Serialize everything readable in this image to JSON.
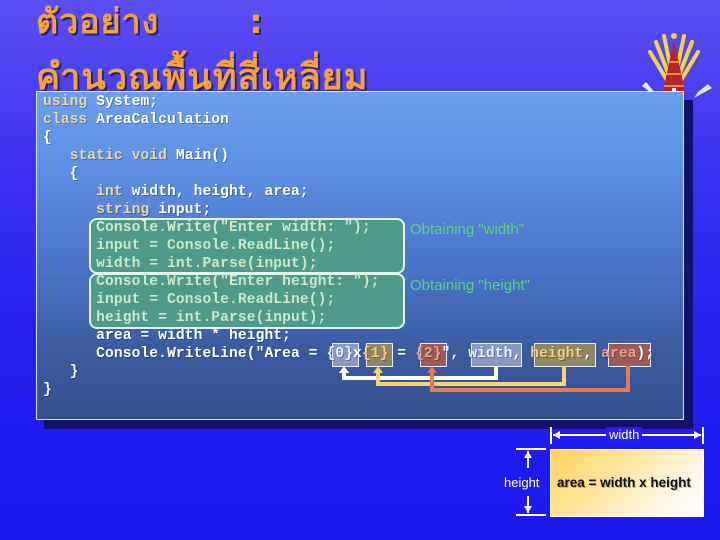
{
  "slide": {
    "title_line1": "ตัวอย่าง       :",
    "title_line2": "คำนวณพื้นที่สี่เหลี่ยม",
    "title_color": "#f4a23a"
  },
  "code": {
    "lines": [
      {
        "kw": "using",
        "rest": " System;"
      },
      {
        "kw": "class",
        "rest": " AreaCalculation"
      },
      {
        "kw": "",
        "rest": "{"
      },
      {
        "kw": "   static void",
        "rest": " Main()"
      },
      {
        "kw": "",
        "rest": "   {"
      },
      {
        "kw": "      int",
        "rest": " width, height, area;"
      },
      {
        "kw": "      string",
        "rest": " input;"
      }
    ],
    "width_block": [
      "      Console.Write(\"Enter width: \");",
      "      input = Console.ReadLine();",
      "      width = int.Parse(input);"
    ],
    "height_block": [
      "      Console.Write(\"Enter height: \");",
      "      input = Console.ReadLine();",
      "      height = int.Parse(input);"
    ],
    "area_line": "      area = width * height;",
    "writeline": {
      "prefix": "      Console.WriteLine(\"Area = ",
      "ph0": "{0}",
      "x": "x",
      "ph1": "{1}",
      "eq": " = ",
      "ph2": "{2}",
      "quote_comma": "\", ",
      "arg_width": "width",
      "comma1": ", ",
      "arg_height": "height",
      "comma2": ", ",
      "arg_area": "area",
      "suffix": ");"
    },
    "close_inner": "   }",
    "close_outer": "}"
  },
  "annotations": {
    "width": "Obtaining \"width\"",
    "height": "Obtaining \"height\""
  },
  "diagram": {
    "width_label": "width",
    "height_label": "height",
    "formula": "area = width x height"
  },
  "colors": {
    "placeholder0": "#8b98bf",
    "placeholder1": "#8e8663",
    "placeholder2": "#9b5a55",
    "arrow_width": "#ffffff",
    "arrow_height": "#f6d377",
    "arrow_area": "#e27a55",
    "annotation": "#58d38a"
  }
}
